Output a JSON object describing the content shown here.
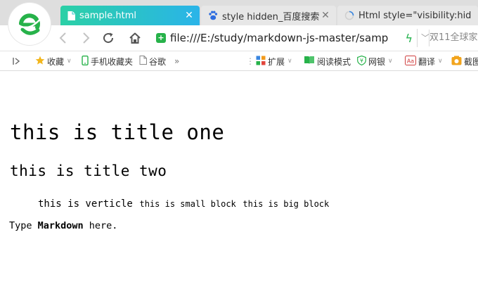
{
  "tabs": [
    {
      "title": "sample.html",
      "active": true,
      "close": "✕"
    },
    {
      "title": "style hidden_百度搜索",
      "active": false,
      "close": "✕"
    },
    {
      "title": "Html style=\"visibility:hid",
      "active": false,
      "close": ""
    }
  ],
  "address": {
    "url": "file:///E:/study/markdown-js-master/samp",
    "search_hint": "双11全球家"
  },
  "bookmarks": {
    "items": [
      {
        "label": "收藏",
        "icon": "star-icon"
      },
      {
        "label": "手机收藏夹",
        "icon": "phone-icon"
      },
      {
        "label": "谷歌",
        "icon": "page-icon"
      }
    ],
    "more": "»",
    "tools": [
      {
        "label": "扩展",
        "icon": "extensions-icon"
      },
      {
        "label": "阅读模式",
        "icon": "book-icon"
      },
      {
        "label": "网银",
        "icon": "bank-shield-icon"
      },
      {
        "label": "翻译",
        "icon": "translate-icon"
      },
      {
        "label": "截图",
        "icon": "screenshot-icon"
      }
    ]
  },
  "page": {
    "title_one": "this is title one",
    "title_two": "this is title two",
    "verticle": "this is verticle",
    "small_block": "this is small block",
    "big_block": "this is big block",
    "type_prefix": "Type ",
    "markdown_word": "Markdown",
    "type_suffix": " here."
  },
  "colors": {
    "tab_gradient_start": "#2bd0a6",
    "tab_gradient_end": "#2ab4e9",
    "accent_green": "#22b24b"
  }
}
